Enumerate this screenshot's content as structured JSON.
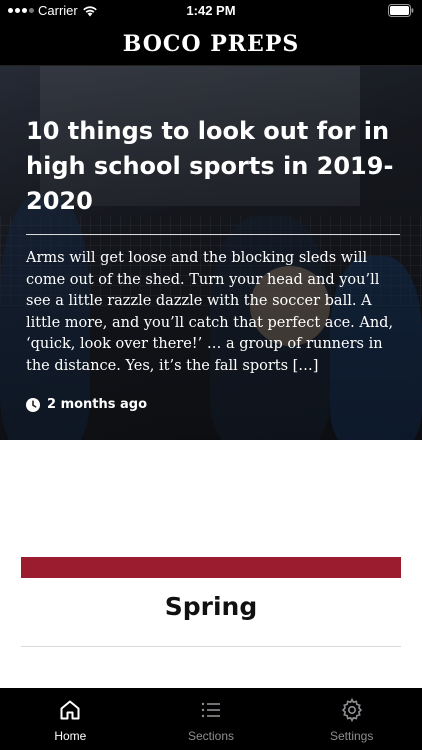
{
  "status_bar": {
    "carrier": "Carrier",
    "time": "1:42 PM"
  },
  "app": {
    "title": "BOCO PREPS"
  },
  "hero": {
    "title": "10 things to look out for in high school sports in 2019-2020",
    "excerpt": "Arms will get loose and the blocking sleds will come out of the shed. Turn your head and you’ll see a little razzle dazzle with the soccer ball. A little more, and you’ll catch that perfect ace. And, ‘quick, look over there!’ … a group of runners in the distance. Yes, it’s the fall sports […]",
    "time_ago": "2 months ago",
    "meta_icon": "clock-icon"
  },
  "section": {
    "title": "Spring",
    "accent_color": "#9b1c2e"
  },
  "tabs": [
    {
      "label": "Home",
      "icon": "home-icon",
      "active": true
    },
    {
      "label": "Sections",
      "icon": "list-icon",
      "active": false
    },
    {
      "label": "Settings",
      "icon": "gear-icon",
      "active": false
    }
  ]
}
